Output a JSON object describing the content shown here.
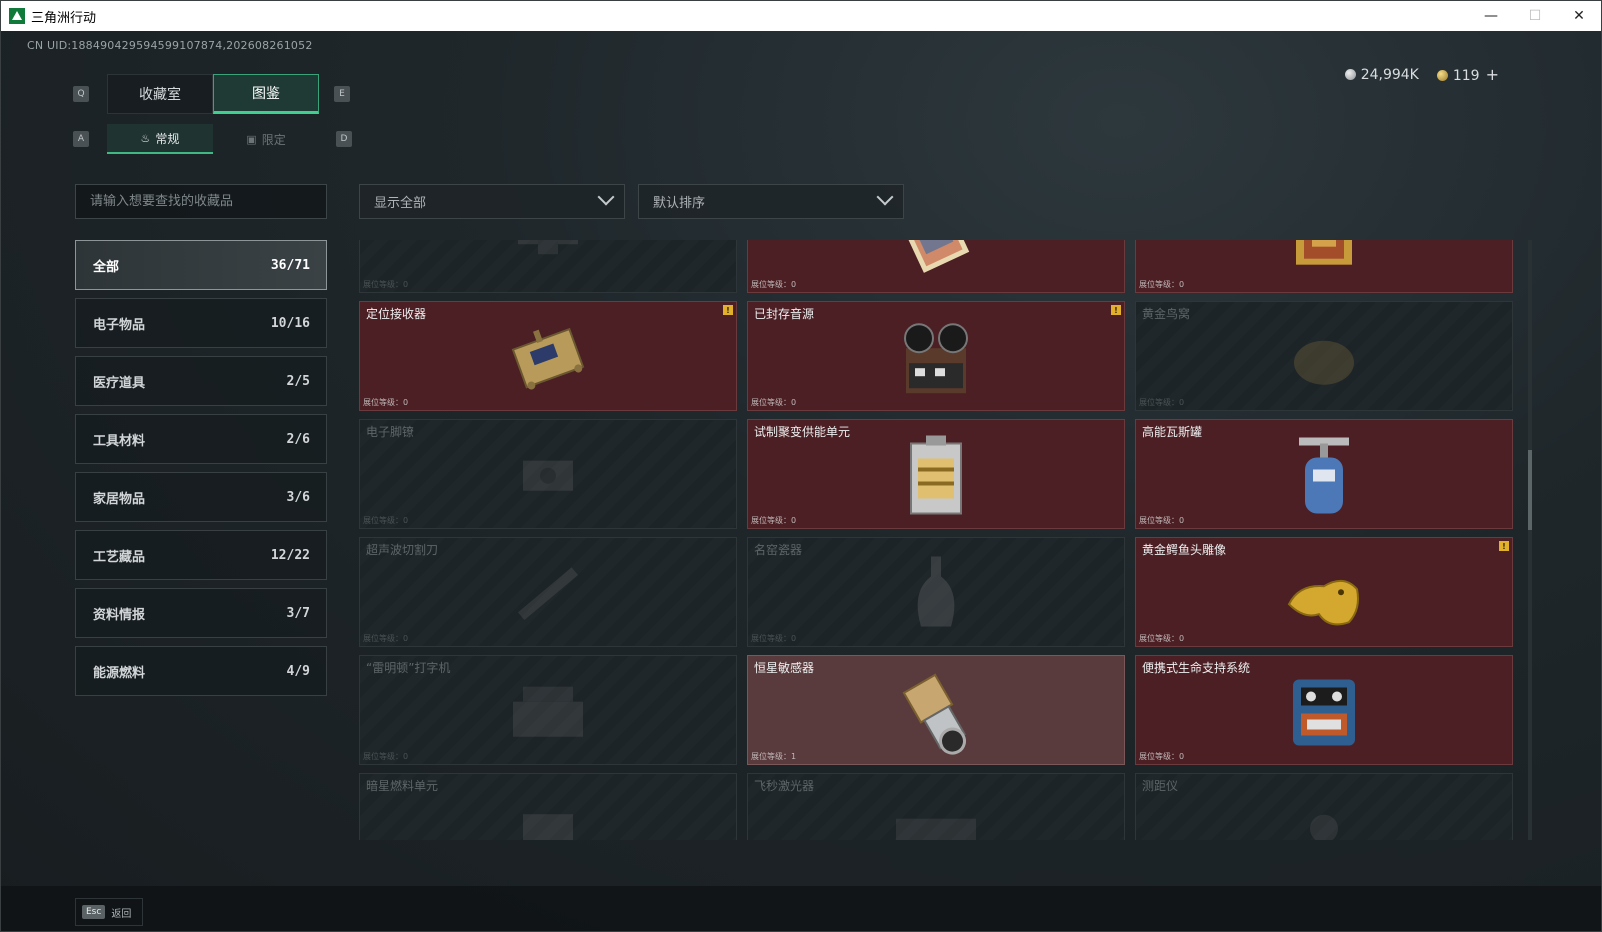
{
  "window": {
    "title": "三角洲行动",
    "minimize": "—",
    "maximize": "☐",
    "close": "✕"
  },
  "uid": "CN UID:188490429594599107874,202608261052",
  "currency": {
    "silver": "24,994K",
    "gold": "119",
    "plus": "+"
  },
  "keyhints": {
    "q": "Q",
    "e": "E",
    "a": "A",
    "d": "D"
  },
  "tabs": [
    {
      "label": "收藏室"
    },
    {
      "label": "图鉴"
    }
  ],
  "subtabs": [
    {
      "label": "常规"
    },
    {
      "label": "限定"
    }
  ],
  "search": {
    "placeholder": "请输入想要查找的收藏品"
  },
  "filters": {
    "show": "显示全部",
    "sort": "默认排序"
  },
  "categories": [
    {
      "label": "全部",
      "count": "36/71"
    },
    {
      "label": "电子物品",
      "count": "10/16"
    },
    {
      "label": "医疗道具",
      "count": "2/5"
    },
    {
      "label": "工具材料",
      "count": "2/6"
    },
    {
      "label": "家居物品",
      "count": "3/6"
    },
    {
      "label": "工艺藏品",
      "count": "12/22"
    },
    {
      "label": "资料情报",
      "count": "3/7"
    },
    {
      "label": "能源燃料",
      "count": "4/9"
    }
  ],
  "level_label": "展位等级：",
  "badge": "!",
  "items": [
    {
      "name": "",
      "level": "0",
      "state": "locked",
      "icon": "rifle-scope-icon"
    },
    {
      "name": "",
      "level": "0",
      "state": "owned",
      "icon": "manuscript-icon"
    },
    {
      "name": "",
      "level": "0",
      "state": "owned",
      "icon": "golden-frame-icon"
    },
    {
      "name": "定位接收器",
      "level": "0",
      "state": "owned",
      "badge": true,
      "icon": "gps-receiver-icon"
    },
    {
      "name": "已封存音源",
      "level": "0",
      "state": "owned",
      "badge": true,
      "icon": "reel-recorder-icon"
    },
    {
      "name": "黄金鸟窝",
      "level": "0",
      "state": "locked",
      "icon": "golden-nest-icon"
    },
    {
      "name": "电子脚镣",
      "level": "0",
      "state": "locked",
      "icon": "ankle-monitor-icon"
    },
    {
      "name": "试制聚变供能单元",
      "level": "0",
      "state": "owned",
      "icon": "fusion-unit-icon"
    },
    {
      "name": "高能瓦斯罐",
      "level": "0",
      "state": "owned",
      "icon": "gas-canister-icon"
    },
    {
      "name": "超声波切割刀",
      "level": "0",
      "state": "locked",
      "icon": "ultrasonic-cutter-icon"
    },
    {
      "name": "名窑瓷器",
      "level": "0",
      "state": "locked",
      "icon": "porcelain-vase-icon"
    },
    {
      "name": "黄金鳄鱼头雕像",
      "level": "0",
      "state": "owned",
      "badge": true,
      "icon": "gold-crocodile-icon"
    },
    {
      "name": "“雷明顿”打字机",
      "level": "0",
      "state": "locked",
      "icon": "typewriter-icon"
    },
    {
      "name": "恒星敏感器",
      "level": "1",
      "state": "owned level1",
      "icon": "star-sensor-icon"
    },
    {
      "name": "便携式生命支持系统",
      "level": "0",
      "state": "owned",
      "icon": "life-support-icon"
    },
    {
      "name": "暗星燃料单元",
      "level": "0",
      "state": "locked",
      "icon": "fuel-cell-icon"
    },
    {
      "name": "飞秒激光器",
      "level": "0",
      "state": "locked",
      "icon": "laser-icon"
    },
    {
      "name": "测距仪",
      "level": "0",
      "state": "locked",
      "icon": "rangefinder-icon"
    }
  ],
  "back": {
    "key": "Esc",
    "label": "返回"
  }
}
